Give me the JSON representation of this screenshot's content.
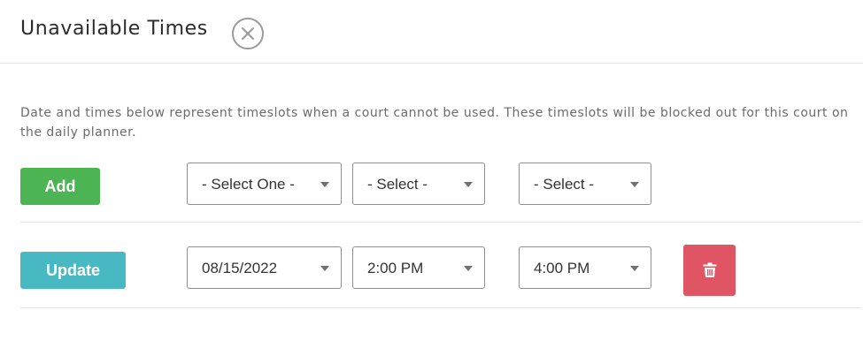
{
  "modal": {
    "title": "Unavailable Times"
  },
  "description": "Date and times below represent timeslots when a court cannot be used. These timeslots will be blocked out for this court on the daily planner.",
  "add_row": {
    "button_label": "Add",
    "date_select": "- Select One -",
    "start_time_select": "- Select -",
    "end_time_select": "- Select -"
  },
  "entries": [
    {
      "button_label": "Update",
      "date": "08/15/2022",
      "start_time": "2:00 PM",
      "end_time": "4:00 PM",
      "delete_icon": "trash-icon"
    }
  ],
  "colors": {
    "add": "#4cb453",
    "update": "#48b8c3",
    "delete": "#e05563"
  },
  "icons": {
    "close": "close-icon",
    "dropdown": "chevron-down-icon",
    "delete": "trash-icon"
  }
}
